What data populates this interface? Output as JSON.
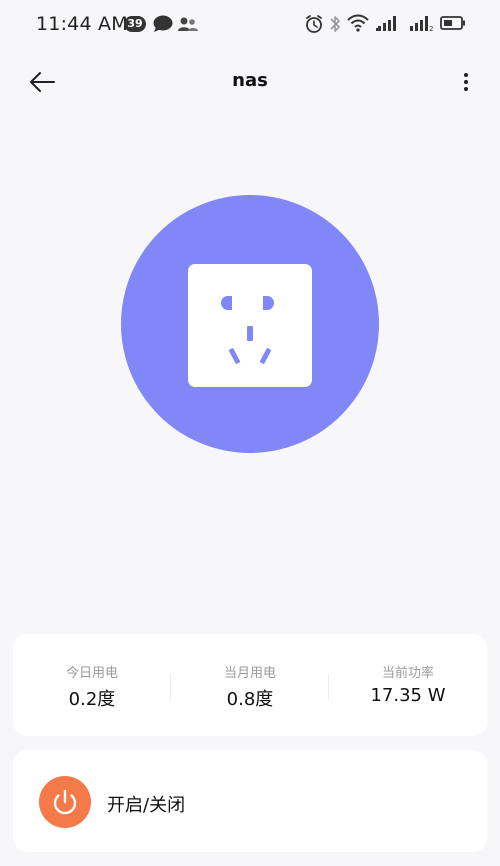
{
  "status_bar": {
    "time": "11:44 AM",
    "notification_count": "39",
    "icons": [
      "message-icon",
      "contacts-icon",
      "alarm-icon",
      "bluetooth-icon",
      "wifi-icon",
      "signal-icon",
      "signal-2-icon",
      "battery-icon"
    ]
  },
  "header": {
    "title": "nas",
    "back_icon": "arrow-left-icon",
    "more_icon": "more-vertical-icon"
  },
  "device": {
    "illustration": "socket-icon"
  },
  "stats": [
    {
      "label": "今日用电",
      "value": "0.2度"
    },
    {
      "label": "当月用电",
      "value": "0.8度"
    },
    {
      "label": "当前功率",
      "value": "17.35 W"
    }
  ],
  "power": {
    "label": "开启/关闭",
    "icon": "power-icon"
  },
  "colors": {
    "background": "#f7f7f9",
    "socket_circle": "#8287f8",
    "power_button": "#f57a4a",
    "card": "#ffffff"
  }
}
